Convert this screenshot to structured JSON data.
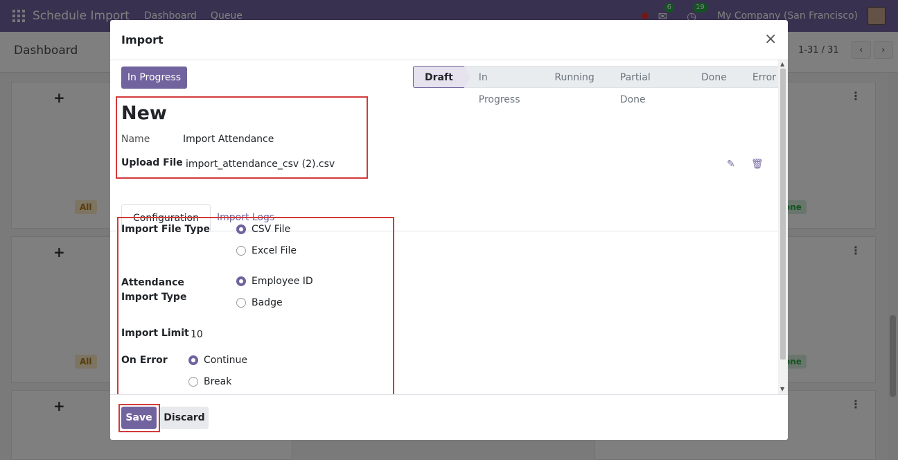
{
  "navbar": {
    "app_name": "Schedule Import",
    "menu": [
      "Dashboard",
      "Queue"
    ],
    "messages_count": "6",
    "activities_count": "19",
    "company": "My Company (San Francisco)"
  },
  "control_panel": {
    "breadcrumb": "Dashboard",
    "pager": "1-31 / 31"
  },
  "background": {
    "badge_all": "All",
    "badge_done": "one"
  },
  "dialog": {
    "title": "Import",
    "close_glyph": "×",
    "status_button": "In Progress",
    "statusbar": [
      "Draft",
      "In Progress",
      "Running",
      "Partial Done",
      "Done",
      "Error"
    ],
    "active_stage": "Draft",
    "record_title": "New",
    "name_label": "Name",
    "name_value": "Import Attendance",
    "upload_label": "Upload File",
    "upload_value": "import_attendance_csv (2).csv",
    "tabs": [
      "Configuration",
      "Import Logs"
    ],
    "config": {
      "file_type_label": "Import File Type",
      "file_type_options": [
        "CSV File",
        "Excel File"
      ],
      "file_type_selected": "CSV File",
      "attendance_label": "Attendance Import Type",
      "attendance_options": [
        "Employee ID",
        "Badge"
      ],
      "attendance_selected": "Employee ID",
      "limit_label": "Import Limit",
      "limit_value": "10",
      "on_error_label": "On Error",
      "on_error_options": [
        "Continue",
        "Break"
      ],
      "on_error_selected": "Continue"
    },
    "save_label": "Save",
    "discard_label": "Discard"
  },
  "colors": {
    "brand": "#71639e",
    "highlight": "#d33a3a"
  }
}
